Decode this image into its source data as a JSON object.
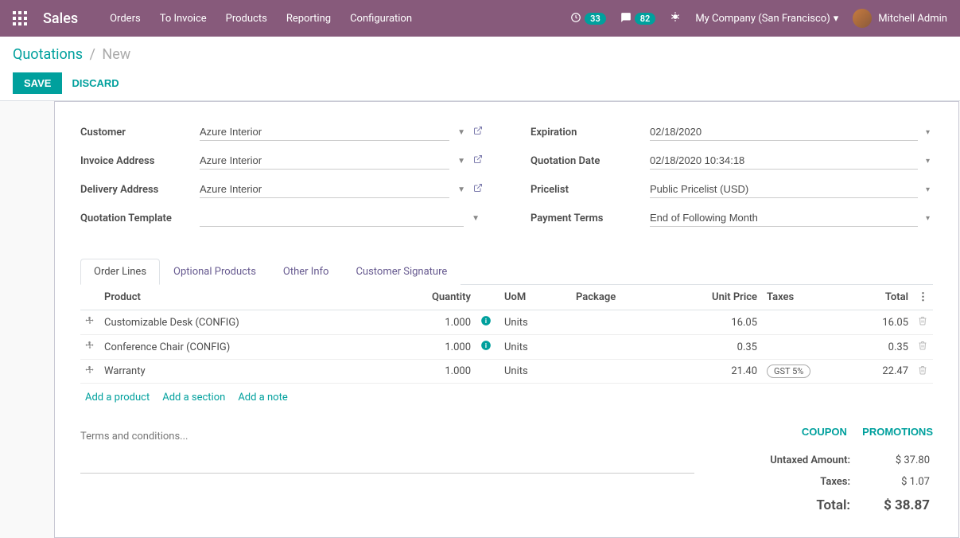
{
  "nav": {
    "app_title": "Sales",
    "menu": [
      "Orders",
      "To Invoice",
      "Products",
      "Reporting",
      "Configuration"
    ],
    "clock_badge": "33",
    "msg_badge": "82",
    "company": "My Company (San Francisco)",
    "user": "Mitchell Admin"
  },
  "breadcrumb": {
    "root": "Quotations",
    "current": "New"
  },
  "buttons": {
    "save": "SAVE",
    "discard": "DISCARD"
  },
  "fields": {
    "customer_label": "Customer",
    "customer_value": "Azure Interior",
    "invoice_addr_label": "Invoice Address",
    "invoice_addr_value": "Azure Interior",
    "delivery_addr_label": "Delivery Address",
    "delivery_addr_value": "Azure Interior",
    "template_label": "Quotation Template",
    "template_value": "",
    "expiration_label": "Expiration",
    "expiration_value": "02/18/2020",
    "qdate_label": "Quotation Date",
    "qdate_value": "02/18/2020 10:34:18",
    "pricelist_label": "Pricelist",
    "pricelist_value": "Public Pricelist (USD)",
    "payment_terms_label": "Payment Terms",
    "payment_terms_value": "End of Following Month"
  },
  "tabs": [
    "Order Lines",
    "Optional Products",
    "Other Info",
    "Customer Signature"
  ],
  "table": {
    "headers": {
      "product": "Product",
      "quantity": "Quantity",
      "uom": "UoM",
      "package": "Package",
      "unit_price": "Unit Price",
      "taxes": "Taxes",
      "total": "Total"
    },
    "rows": [
      {
        "product": "Customizable Desk (CONFIG)",
        "qty": "1.000",
        "info": true,
        "uom": "Units",
        "package": "",
        "unit_price": "16.05",
        "taxes": "",
        "total": "16.05"
      },
      {
        "product": "Conference Chair (CONFIG)",
        "qty": "1.000",
        "info": true,
        "uom": "Units",
        "package": "",
        "unit_price": "0.35",
        "taxes": "",
        "total": "0.35"
      },
      {
        "product": "Warranty",
        "qty": "1.000",
        "info": false,
        "uom": "Units",
        "package": "",
        "unit_price": "21.40",
        "taxes": "GST 5%",
        "total": "22.47"
      }
    ],
    "add_links": {
      "product": "Add a product",
      "section": "Add a section",
      "note": "Add a note"
    }
  },
  "terms_placeholder": "Terms and conditions...",
  "promo": {
    "coupon": "COUPON",
    "promotions": "PROMOTIONS"
  },
  "totals": {
    "untaxed_label": "Untaxed Amount:",
    "untaxed_value": "$ 37.80",
    "taxes_label": "Taxes:",
    "taxes_value": "$ 1.07",
    "total_label": "Total:",
    "total_value": "$ 38.87"
  }
}
